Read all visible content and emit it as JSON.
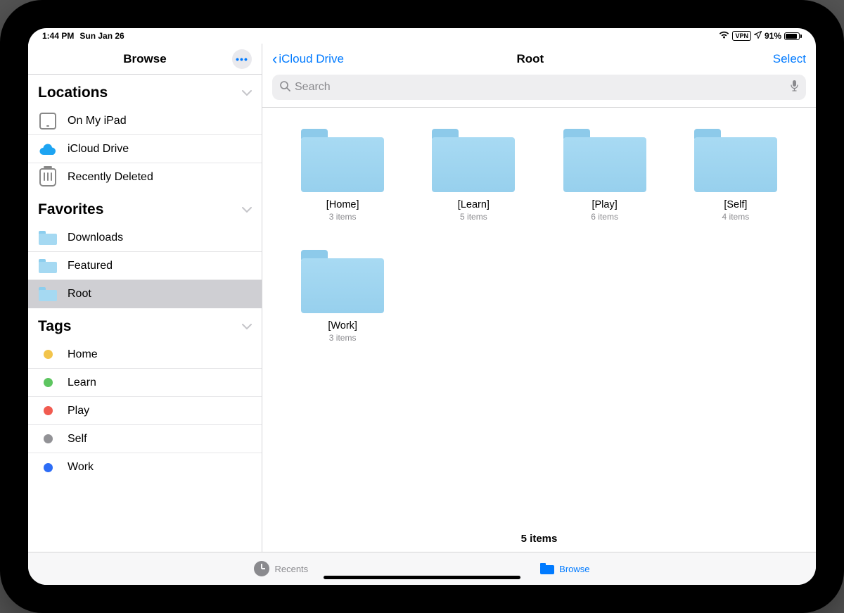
{
  "status_bar": {
    "time": "1:44 PM",
    "date": "Sun Jan 26",
    "vpn_label": "VPN",
    "battery_percent": "91%"
  },
  "sidebar": {
    "title": "Browse",
    "sections": [
      {
        "title": "Locations",
        "items": [
          {
            "label": "On My iPad",
            "icon": "ipad",
            "selected": false
          },
          {
            "label": "iCloud Drive",
            "icon": "cloud",
            "selected": false
          },
          {
            "label": "Recently Deleted",
            "icon": "trash",
            "selected": false
          }
        ]
      },
      {
        "title": "Favorites",
        "items": [
          {
            "label": "Downloads",
            "icon": "folder",
            "color": "#a5d9f2",
            "selected": false
          },
          {
            "label": "Featured",
            "icon": "folder",
            "color": "#a5d9f2",
            "selected": false
          },
          {
            "label": "Root",
            "icon": "folder",
            "color": "#a5d9f2",
            "selected": true
          }
        ]
      },
      {
        "title": "Tags",
        "items": [
          {
            "label": "Home",
            "icon": "tag",
            "color": "#f2c44b"
          },
          {
            "label": "Learn",
            "icon": "tag",
            "color": "#5dc560"
          },
          {
            "label": "Play",
            "icon": "tag",
            "color": "#f15b50"
          },
          {
            "label": "Self",
            "icon": "tag",
            "color": "#929296"
          },
          {
            "label": "Work",
            "icon": "tag",
            "color": "#2d6df6"
          }
        ]
      }
    ]
  },
  "content": {
    "back_label": "iCloud Drive",
    "title": "Root",
    "select_label": "Select",
    "search_placeholder": "Search",
    "folders": [
      {
        "name": "[Home]",
        "count": "3 items"
      },
      {
        "name": "[Learn]",
        "count": "5 items"
      },
      {
        "name": "[Play]",
        "count": "6 items"
      },
      {
        "name": "[Self]",
        "count": "4 items"
      },
      {
        "name": "[Work]",
        "count": "3 items"
      }
    ],
    "summary": "5 items"
  },
  "bottom_tabs": {
    "recents": "Recents",
    "browse": "Browse"
  }
}
